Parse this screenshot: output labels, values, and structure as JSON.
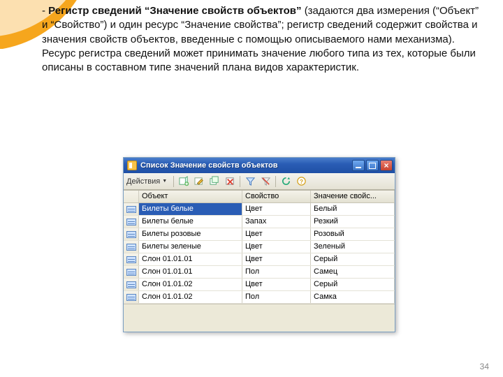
{
  "paragraph": {
    "dash": "- ",
    "bold": "Регистр сведений “Значение свойств объектов” ",
    "rest": "(задаются два измерения (“Объект” и “Свойство”) и один ресурс “Значение свойства”; регистр сведений содержит свойства и значения свойств объектов, введенные с помощью описываемого нами механизма). Ресурс регистра сведений может принимать значение любого типа из тех, которые были описаны в составном типе значений плана видов характеристик."
  },
  "page_number": "34",
  "window": {
    "title": "Список  Значение свойств объектов",
    "actions_label": "Действия",
    "columns": {
      "c1": "Объект",
      "c2": "Свойство",
      "c3": "Значение свойс..."
    },
    "rows": [
      {
        "c1": "Билеты белые",
        "c2": "Цвет",
        "c3": "Белый",
        "sel": true
      },
      {
        "c1": "Билеты белые",
        "c2": "Запах",
        "c3": "Резкий",
        "sel": false
      },
      {
        "c1": "Билеты розовые",
        "c2": "Цвет",
        "c3": "Розовый",
        "sel": false
      },
      {
        "c1": "Билеты зеленые",
        "c2": "Цвет",
        "c3": "Зеленый",
        "sel": false
      },
      {
        "c1": "Слон 01.01.01",
        "c2": "Цвет",
        "c3": "Серый",
        "sel": false
      },
      {
        "c1": "Слон 01.01.01",
        "c2": "Пол",
        "c3": "Самец",
        "sel": false
      },
      {
        "c1": "Слон 01.01.02",
        "c2": "Цвет",
        "c3": "Серый",
        "sel": false
      },
      {
        "c1": "Слон 01.01.02",
        "c2": "Пол",
        "c3": "Самка",
        "sel": false
      }
    ]
  }
}
